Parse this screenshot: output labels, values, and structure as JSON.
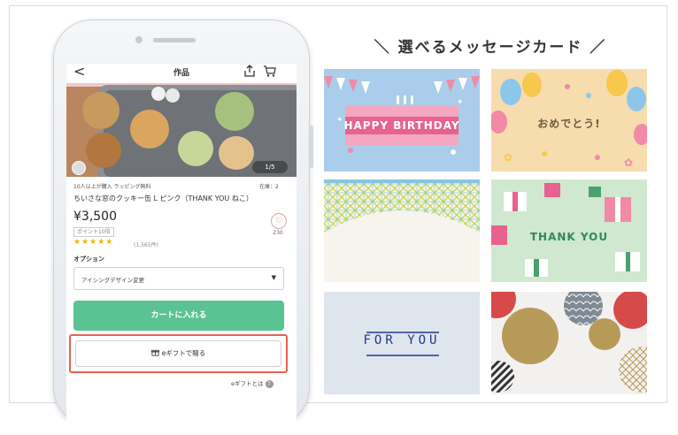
{
  "app": {
    "nav_title": "作品",
    "back_label": "<"
  },
  "product": {
    "photo_counter": "1/5",
    "meta_left": "10人以上が購入  ラッピング無料",
    "meta_right": "在庫：2",
    "title": "ちいさな窓のクッキー缶 L ピンク（THANK YOU ねこ）",
    "price": "¥3,500",
    "points_label": "ポイント10倍",
    "stars": "★★★★★",
    "reviews_label": "(1,565件)",
    "favorite_count": "230",
    "option_label": "オプション",
    "option_value": "アイシングデザイン変更",
    "add_to_cart_label": "カートに入れる",
    "egift_button_label": "eギフトで贈る",
    "egift_help_label": "eギフトとは"
  },
  "message_cards": {
    "heading": "＼ 選べるメッセージカード ／",
    "cards": [
      {
        "name": "happy-birthday",
        "text": "HAPPY BIRTHDAY"
      },
      {
        "name": "omedetou",
        "text": "おめでとう!"
      },
      {
        "name": "lattice",
        "text": ""
      },
      {
        "name": "thank-you",
        "text": "THANK YOU"
      },
      {
        "name": "for-you",
        "text": "FOR YOU"
      },
      {
        "name": "circles",
        "text": ""
      }
    ]
  },
  "colors": {
    "accent_green": "#5bc393",
    "highlight_red": "#e9614f",
    "star_yellow": "#f0b400"
  }
}
